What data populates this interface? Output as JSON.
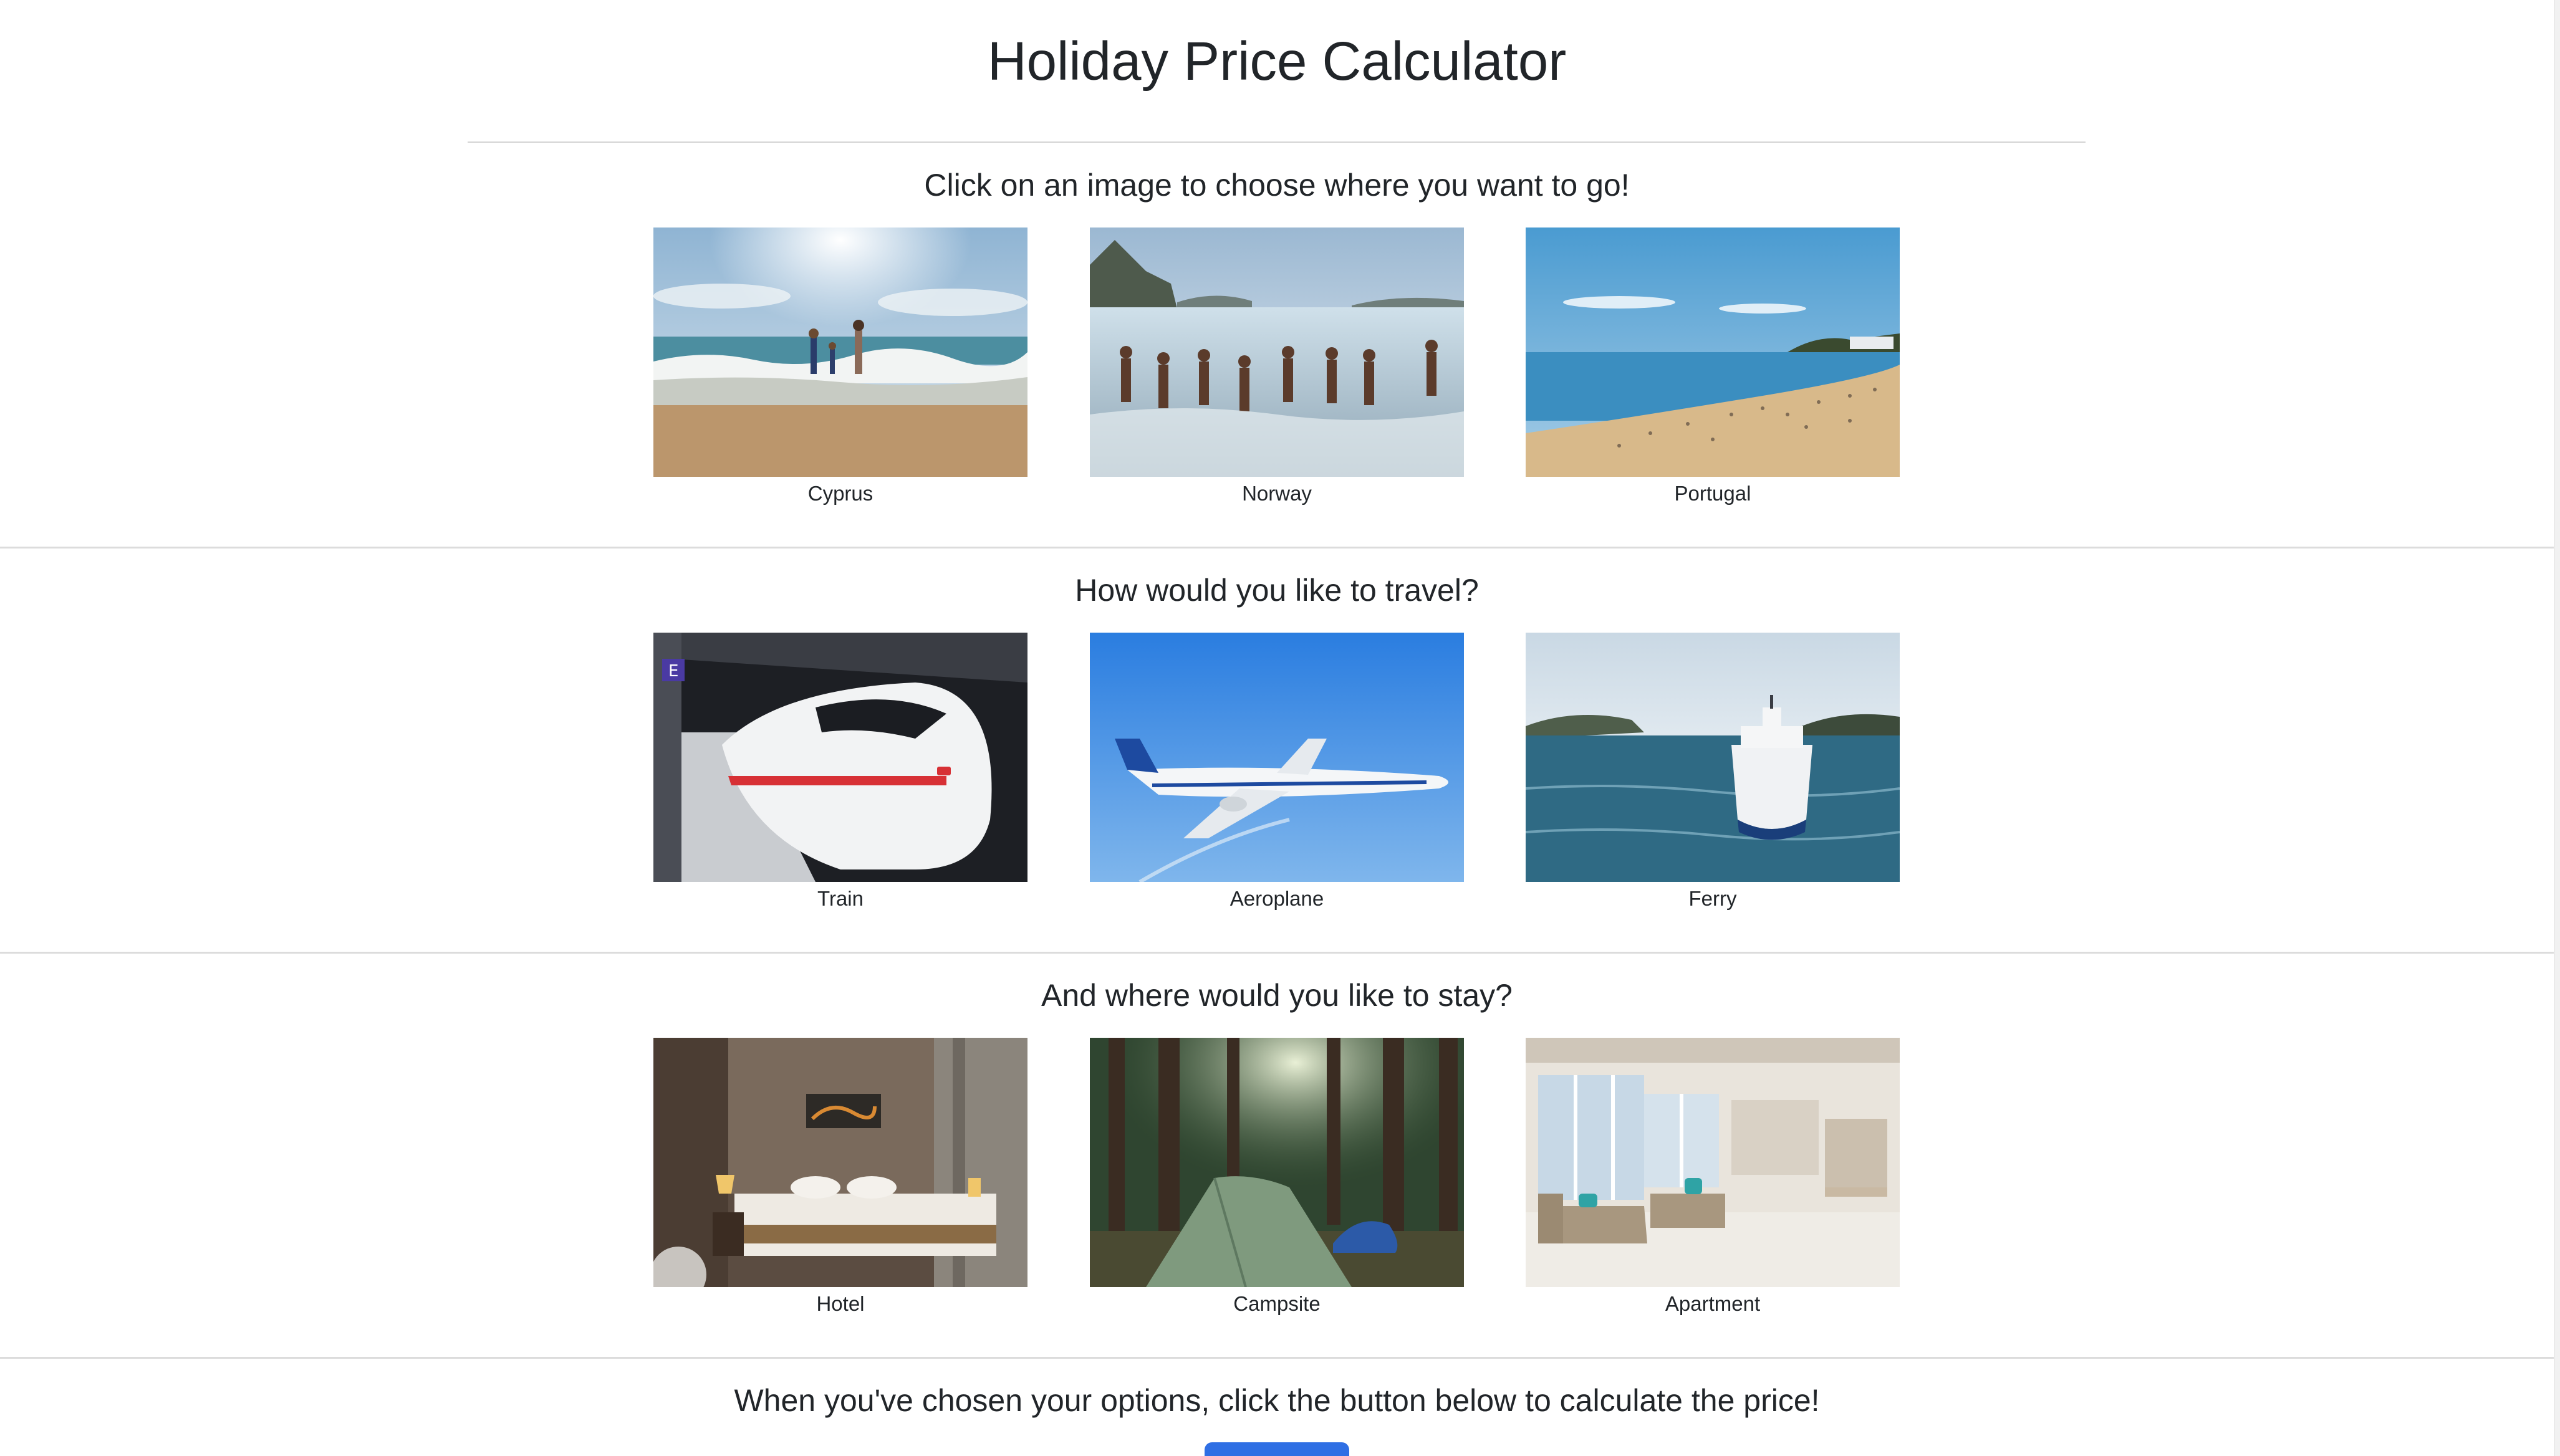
{
  "page": {
    "title": "Holiday Price Calculator"
  },
  "sections": {
    "destination": {
      "heading": "Click on an image to choose where you want to go!",
      "options": [
        {
          "label": "Cyprus"
        },
        {
          "label": "Norway"
        },
        {
          "label": "Portugal"
        }
      ]
    },
    "travel": {
      "heading": "How would you like to travel?",
      "options": [
        {
          "label": "Train"
        },
        {
          "label": "Aeroplane"
        },
        {
          "label": "Ferry"
        }
      ]
    },
    "stay": {
      "heading": "And where would you like to stay?",
      "options": [
        {
          "label": "Hotel"
        },
        {
          "label": "Campsite"
        },
        {
          "label": "Apartment"
        }
      ]
    }
  },
  "footer": {
    "instruction": "When you've chosen your options, click the button below to calculate the price!",
    "button_label": ""
  },
  "colors": {
    "button_blue": "#2f6fe4",
    "divider": "#dcdcdc"
  }
}
